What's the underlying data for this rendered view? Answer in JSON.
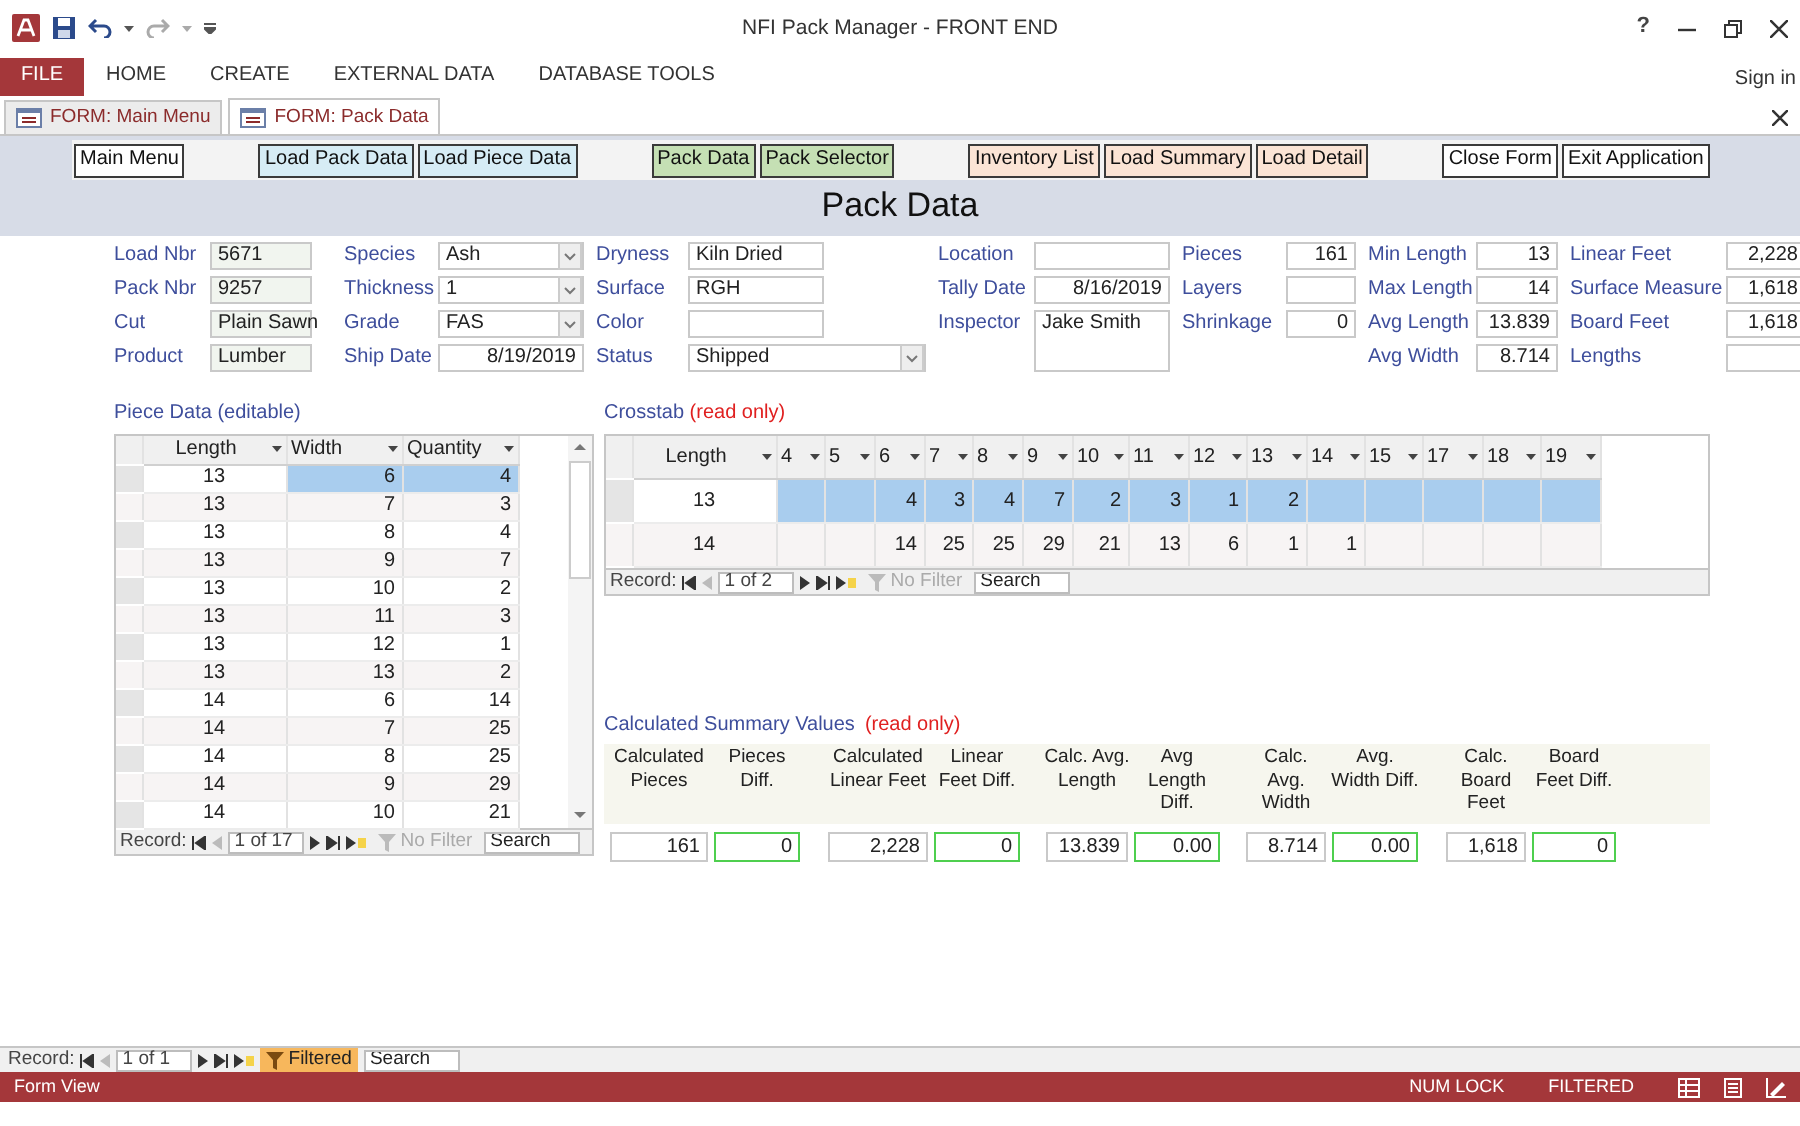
{
  "window": {
    "title": "NFI Pack Manager - FRONT END",
    "help": "?"
  },
  "ribbon": {
    "file_button": "FILE",
    "tabs": [
      "HOME",
      "CREATE",
      "EXTERNAL DATA",
      "DATABASE TOOLS"
    ],
    "sign_in": "Sign in"
  },
  "document_tabs": [
    {
      "label": "FORM: Main Menu",
      "selected": false
    },
    {
      "label": "FORM: Pack Data",
      "selected": true
    }
  ],
  "toolbar_groups": [
    [
      {
        "label": "Main Menu",
        "color": "#ffffff"
      }
    ],
    [
      {
        "label": "Load Pack Data",
        "color": "#d6ecf5"
      },
      {
        "label": "Load Piece Data",
        "color": "#d6ecf5"
      }
    ],
    [
      {
        "label": "Pack Data",
        "color": "#c5e0b4"
      },
      {
        "label": "Pack Selector",
        "color": "#c5e0b4"
      }
    ],
    [
      {
        "label": "Inventory List",
        "color": "#fbe4d5"
      },
      {
        "label": "Load Summary",
        "color": "#fbe4d5"
      },
      {
        "label": "Load Detail",
        "color": "#fbe4d5"
      }
    ],
    [
      {
        "label": "Close Form",
        "color": "#ffffff"
      },
      {
        "label": "Exit Application",
        "color": "#ffffff"
      }
    ]
  ],
  "form_title": "Pack Data",
  "field_columns": [
    [
      {
        "label": "Load Nbr",
        "value": "5671",
        "kind": "locked"
      },
      {
        "label": "Pack Nbr",
        "value": "9257",
        "kind": "locked"
      },
      {
        "label": "Cut",
        "value": "Plain Sawn",
        "kind": "locked"
      },
      {
        "label": "Product",
        "value": "Lumber",
        "kind": "locked"
      }
    ],
    [
      {
        "label": "Species",
        "value": "Ash",
        "kind": "combo"
      },
      {
        "label": "Thickness",
        "value": "1",
        "kind": "combo"
      },
      {
        "label": "Grade",
        "value": "FAS",
        "kind": "combo"
      },
      {
        "label": "Ship Date",
        "value": "8/19/2019",
        "kind": "number"
      }
    ],
    [
      {
        "label": "Dryness",
        "value": "Kiln Dried",
        "kind": "text"
      },
      {
        "label": "Surface",
        "value": "RGH",
        "kind": "text"
      },
      {
        "label": "Color",
        "kind": "text"
      },
      {
        "label": "Status",
        "value": "Shipped",
        "kind": "combo"
      }
    ],
    [
      {
        "label": "Location",
        "kind": "text"
      },
      {
        "label": "Tally Date",
        "value": "8/16/2019",
        "kind": "number"
      },
      {
        "label": "Inspector",
        "value": "Jake Smith",
        "kind": "memo"
      }
    ],
    [
      {
        "label": "Pieces",
        "value": "161",
        "kind": "number"
      },
      {
        "label": "Layers",
        "kind": "number"
      },
      {
        "label": "Shrinkage",
        "value": "0",
        "kind": "number"
      }
    ],
    [
      {
        "label": "Min Length",
        "value": "13",
        "kind": "number"
      },
      {
        "label": "Max Length",
        "value": "14",
        "kind": "number"
      },
      {
        "label": "Avg Length",
        "value": "13.839",
        "kind": "number"
      },
      {
        "label": "Avg Width",
        "value": "8.714",
        "kind": "number"
      }
    ],
    [
      {
        "label": "Linear Feet",
        "value": "2,228",
        "kind": "number"
      },
      {
        "label": "Surface Measure",
        "value": "1,618",
        "kind": "number"
      },
      {
        "label": "Board Feet",
        "value": "1,618",
        "kind": "number"
      },
      {
        "label": "Lengths",
        "kind": "number"
      }
    ]
  ],
  "piece_data": {
    "title": "Piece Data (editable)",
    "columns": [
      "Length",
      "Width",
      "Quantity"
    ],
    "rows": [
      {
        "cells": [
          "13",
          "6",
          "4"
        ],
        "selected": true
      },
      {
        "cells": [
          "13",
          "7",
          "3"
        ],
        "selected": false
      },
      {
        "cells": [
          "13",
          "8",
          "4"
        ],
        "selected": false
      },
      {
        "cells": [
          "13",
          "9",
          "7"
        ],
        "selected": false
      },
      {
        "cells": [
          "13",
          "10",
          "2"
        ],
        "selected": false
      },
      {
        "cells": [
          "13",
          "11",
          "3"
        ],
        "selected": false
      },
      {
        "cells": [
          "13",
          "12",
          "1"
        ],
        "selected": false
      },
      {
        "cells": [
          "13",
          "13",
          "2"
        ],
        "selected": false
      },
      {
        "cells": [
          "14",
          "6",
          "14"
        ],
        "selected": false
      },
      {
        "cells": [
          "14",
          "7",
          "25"
        ],
        "selected": false
      },
      {
        "cells": [
          "14",
          "8",
          "25"
        ],
        "selected": false
      },
      {
        "cells": [
          "14",
          "9",
          "29"
        ],
        "selected": false
      },
      {
        "cells": [
          "14",
          "10",
          "21"
        ],
        "selected": false
      }
    ],
    "navigator": {
      "label": "Record:",
      "position": "1 of 17",
      "filter": "No Filter",
      "filtered": false,
      "placeholder": "Search"
    }
  },
  "crosstab": {
    "title": "Crosstab",
    "note": "(read only)",
    "columns": [
      "Length",
      "4",
      "5",
      "6",
      "7",
      "8",
      "9",
      "10",
      "11",
      "12",
      "13",
      "14",
      "15",
      "17",
      "18",
      "19"
    ],
    "rows": [
      {
        "cells": [
          "13",
          null,
          null,
          "4",
          "3",
          "4",
          "7",
          "2",
          "3",
          "1",
          "2",
          null,
          null,
          null,
          null,
          null
        ],
        "selected": true
      },
      {
        "cells": [
          "14",
          null,
          null,
          "14",
          "25",
          "25",
          "29",
          "21",
          "13",
          "6",
          "1",
          "1",
          null,
          null,
          null,
          null
        ],
        "selected": false
      }
    ],
    "navigator": {
      "label": "Record:",
      "position": "1 of 2",
      "filter": "No Filter",
      "filtered": false,
      "placeholder": "Search"
    }
  },
  "summary": {
    "title": "Calculated Summary Values",
    "note": "(read only)",
    "items": [
      {
        "header": "Calculated Pieces",
        "value": "161",
        "kind": "calc"
      },
      {
        "header": "Pieces Diff.",
        "value": "0",
        "kind": "diff"
      },
      {
        "header": "Calculated Linear Feet",
        "value": "2,228",
        "kind": "calc"
      },
      {
        "header": "Linear Feet Diff.",
        "value": "0",
        "kind": "diff"
      },
      {
        "header": "Calc. Avg. Length",
        "value": "13.839",
        "kind": "calc"
      },
      {
        "header": "Avg Length Diff.",
        "value": "0.00",
        "kind": "diff"
      },
      {
        "header": "Calc. Avg. Width",
        "value": "8.714",
        "kind": "calc"
      },
      {
        "header": "Avg. Width Diff.",
        "value": "0.00",
        "kind": "diff"
      },
      {
        "header": "Calc. Board Feet",
        "value": "1,618",
        "kind": "calc"
      },
      {
        "header": "Board Feet Diff.",
        "value": "0",
        "kind": "diff"
      }
    ]
  },
  "form_navigator": {
    "label": "Record:",
    "position": "1 of 1",
    "filter": "Filtered",
    "filtered": true,
    "placeholder": "Search"
  },
  "status_bar": {
    "mode": "Form View",
    "indicators": [
      "NUM LOCK",
      "FILTERED"
    ]
  }
}
